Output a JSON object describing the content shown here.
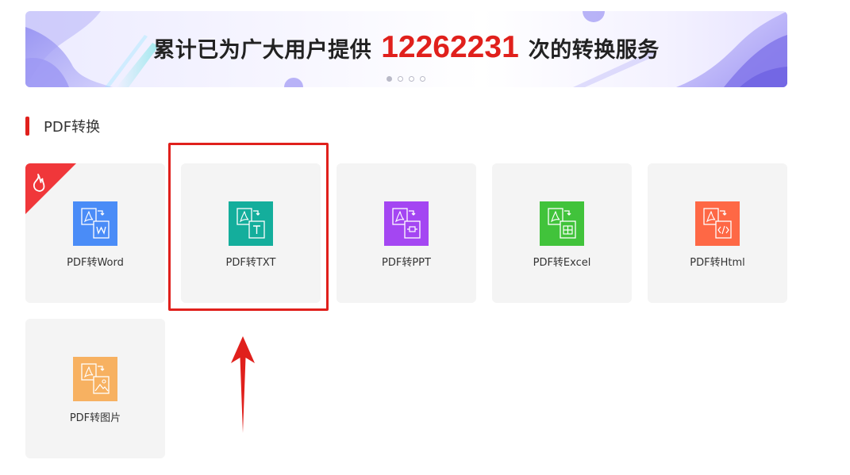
{
  "banner": {
    "text_before": "累计已为广大用户提供",
    "count": "12262231",
    "text_after": "次的转换服务",
    "slides": 4,
    "active_slide": 1
  },
  "section": {
    "title": "PDF转换"
  },
  "cards": [
    {
      "label": "PDF转Word",
      "icon": "pdf-to-word-icon",
      "color": "#4a8cf7",
      "badge": "hot-fire-icon"
    },
    {
      "label": "PDF转TXT",
      "icon": "pdf-to-txt-icon",
      "color": "#14ae9c",
      "highlighted": true
    },
    {
      "label": "PDF转PPT",
      "icon": "pdf-to-ppt-icon",
      "color": "#a446f2"
    },
    {
      "label": "PDF转Excel",
      "icon": "pdf-to-excel-icon",
      "color": "#41c33b"
    },
    {
      "label": "PDF转Html",
      "icon": "pdf-to-html-icon",
      "color": "#fe6845"
    },
    {
      "label": "PDF转图片",
      "icon": "pdf-to-image-icon",
      "color": "#f7b161"
    }
  ],
  "colors": {
    "accent_red": "#e0201c",
    "card_bg": "#f4f4f4",
    "text": "#333333"
  }
}
